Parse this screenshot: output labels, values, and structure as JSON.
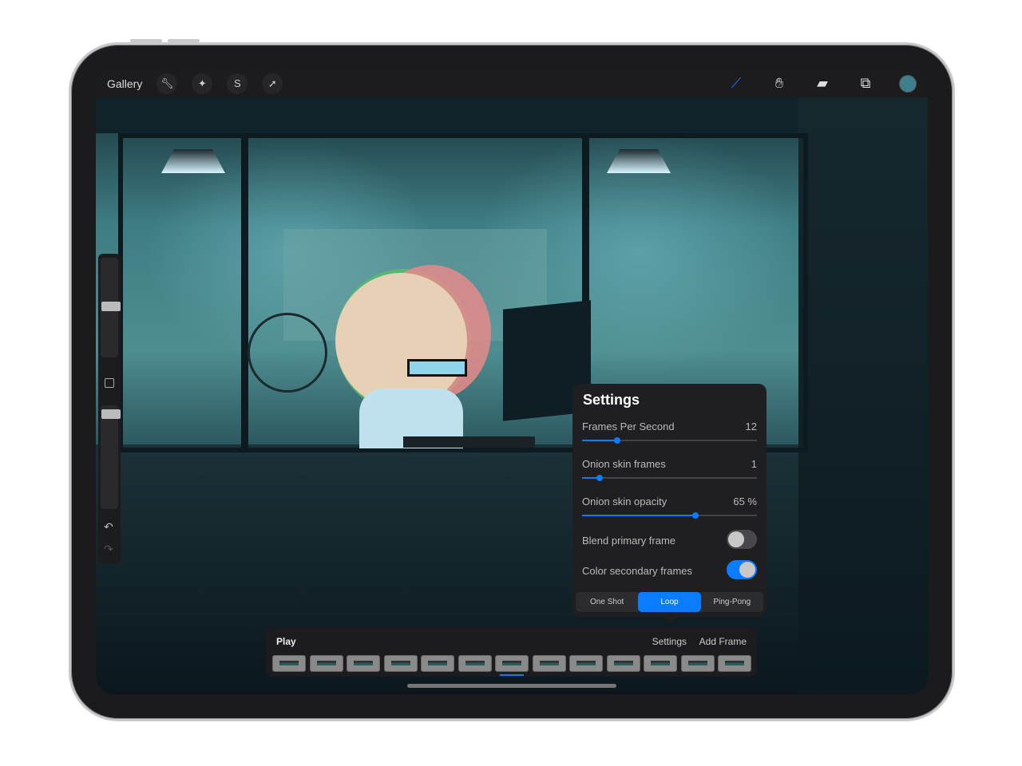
{
  "toolbar": {
    "gallery": "Gallery",
    "left_icons": [
      "wrench-icon",
      "magic-wand-icon",
      "selection-icon",
      "transform-arrow-icon"
    ],
    "right_icons": [
      "brush-icon",
      "smudge-icon",
      "eraser-icon",
      "layers-icon"
    ],
    "current_color": "#3d7f8c"
  },
  "sidebar": {
    "icons": [
      "modify-square-icon",
      "undo-icon",
      "redo-icon"
    ]
  },
  "settings": {
    "title": "Settings",
    "sliders": [
      {
        "label": "Frames Per Second",
        "value": "12",
        "fraction": 0.2
      },
      {
        "label": "Onion skin frames",
        "value": "1",
        "fraction": 0.1
      },
      {
        "label": "Onion skin opacity",
        "value": "65 %",
        "fraction": 0.65
      }
    ],
    "toggles": [
      {
        "label": "Blend primary frame",
        "on": false
      },
      {
        "label": "Color secondary frames",
        "on": true
      }
    ],
    "modes": [
      "One Shot",
      "Loop",
      "Ping-Pong"
    ],
    "selected_mode": "Loop"
  },
  "timeline": {
    "play": "Play",
    "settings": "Settings",
    "add_frame": "Add Frame",
    "frame_count": 13,
    "current_frame": 7
  },
  "colors": {
    "accent": "#0a7cff",
    "panel": "#1f1f21"
  }
}
